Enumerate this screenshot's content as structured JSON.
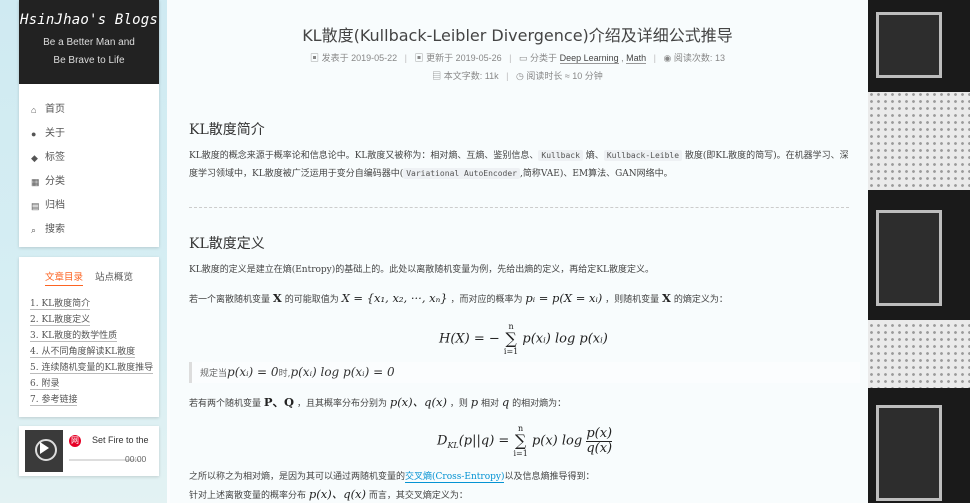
{
  "site": {
    "title": "HsinJhao's Blogs",
    "subtitle_line1": "Be a Better Man and",
    "subtitle_line2": "Be Brave to Life"
  },
  "menu": [
    {
      "icon": "home-icon",
      "glyph": "⌂",
      "label": "首页"
    },
    {
      "icon": "user-icon",
      "glyph": "●",
      "label": "关于"
    },
    {
      "icon": "tag-icon",
      "glyph": "◆",
      "label": "标签"
    },
    {
      "icon": "grid-icon",
      "glyph": "▦",
      "label": "分类"
    },
    {
      "icon": "archive-icon",
      "glyph": "▤",
      "label": "归档"
    },
    {
      "icon": "search-icon",
      "glyph": "⌕",
      "label": "搜索"
    }
  ],
  "toc": {
    "tab_active": "文章目录",
    "tab_other": "站点概览",
    "items": [
      "1. KL散度简介",
      "2. KL散度定义",
      "3. KL散度的数学性质",
      "4. 从不同角度解读KL散度",
      "5. 连续随机变量的KL散度推导",
      "6. 附录",
      "7. 参考链接"
    ]
  },
  "player": {
    "song": "Set Fire to the",
    "time": "00:00",
    "logo": "网"
  },
  "post": {
    "title": "KL散度(Kullback-Leibler Divergence)介绍及详细公式推导",
    "published_label": "发表于",
    "published": "2019-05-22",
    "updated_label": "更新于",
    "updated": "2019-05-26",
    "category_label": "分类于",
    "category1": "Deep Learning",
    "category2": "Math",
    "views_label": "阅读次数:",
    "views": "13",
    "wordcount_label": "本文字数:",
    "wordcount": "11k",
    "readtime_label": "阅读时长 ≈",
    "readtime": "10 分钟"
  },
  "sections": {
    "s1_heading": "KL散度简介",
    "s1_p1_a": "KL散度的概念来源于概率论和信息论中。KL散度又被称为：相对熵、互熵、鉴别信息、",
    "s1_code1": "Kullback",
    "s1_p1_b": " 熵、",
    "s1_code2": "Kullback-Leible",
    "s1_p1_c": " 散度(即KL散度的简写)。在机器学习、深",
    "s1_p2_a": "度学习领域中，KL散度被广泛运用于变分自编码器中(",
    "s1_code3": "Variational AutoEncoder",
    "s1_p2_b": ",简称VAE)、EM算法、GAN网络中。",
    "s2_heading": "KL散度定义",
    "s2_p1": "KL散度的定义是建立在熵(Entropy)的基础上的。此处以离散随机变量为例，先给出熵的定义，再给定KL散度定义。",
    "s2_p2_a": "若一个离散随机变量",
    "s2_p2_b": "的可能取值为",
    "s2_p2_c": "，而对应的概率为",
    "s2_p2_d": "，则随机变量",
    "s2_p2_e": "的熵定义为：",
    "note_a": "规定当",
    "note_b": "时,",
    "s2_p3_a": "若有两个随机变量",
    "s2_p3_b": "，且其概率分布分别为",
    "s2_p3_c": "，则",
    "s2_p3_d": "相对",
    "s2_p3_e": "的相对熵为：",
    "s2_p4_a": "之所以称之为相对熵，是因为其可以通过两随机变量的",
    "s2_p4_link": "交叉熵(Cross-Entropy)",
    "s2_p4_b": "以及信息熵推导得到：",
    "s2_p5_a": "针对上述离散变量的概率分布",
    "s2_p5_b": "而言，其交叉熵定义为："
  }
}
